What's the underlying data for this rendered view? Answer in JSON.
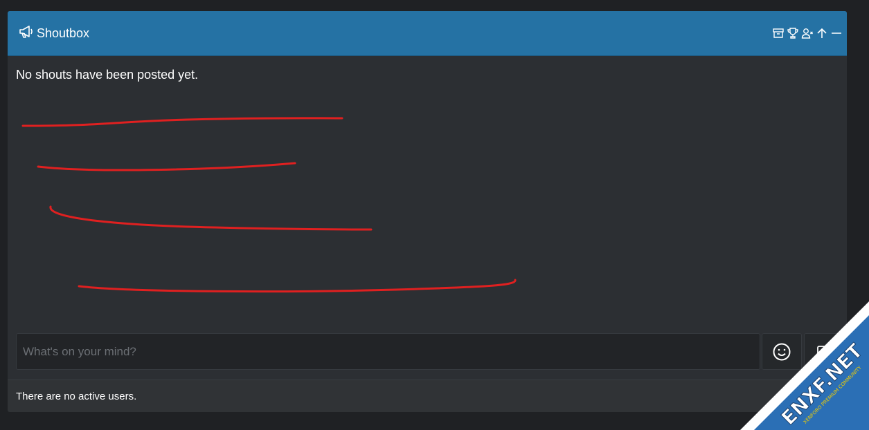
{
  "shoutbox": {
    "title": "Shoutbox",
    "empty_message": "No shouts have been posted yet.",
    "input_placeholder": "What's on your mind?",
    "footer_text": "There are no active users."
  },
  "header_tools": [
    {
      "name": "archive-icon"
    },
    {
      "name": "trophy-icon"
    },
    {
      "name": "user-remove-icon"
    },
    {
      "name": "arrow-up-icon"
    },
    {
      "name": "minimize-icon"
    }
  ],
  "colors": {
    "header": "#2572a4",
    "panel": "#2c2f33",
    "page": "#1f2124",
    "annotation": "#e02020"
  },
  "watermark": {
    "text": "ENXF.NET",
    "subtext": "XENFORO PREMIUM COMMUNITY"
  }
}
